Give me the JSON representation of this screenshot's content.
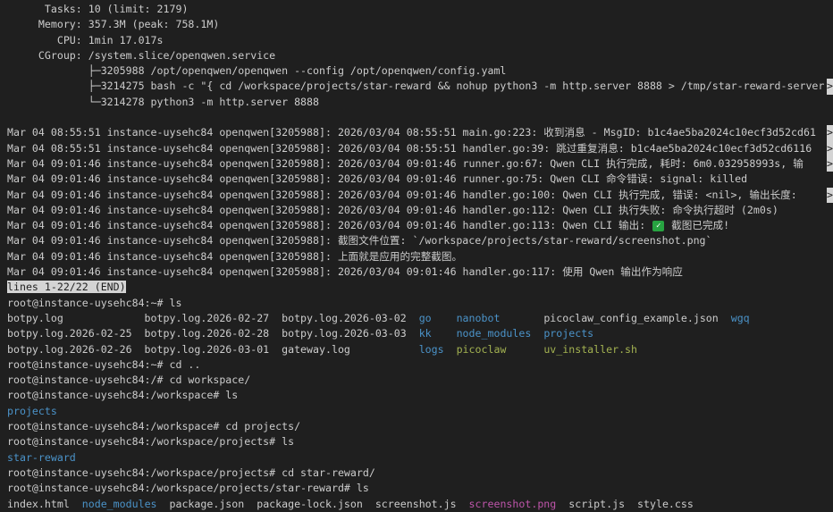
{
  "terminal": {
    "colors": {
      "background": "#1f1f1f",
      "foreground": "#cccccc",
      "directory_blue": "#4b93c9",
      "executable_green": "#a3b251",
      "image_magenta": "#be55aa",
      "inverse_bg": "#d4d4d4",
      "inverse_fg": "#1f1f1f",
      "check_green": "#27a341"
    },
    "service_status": {
      "tasks": "10 (limit: 2179)",
      "memory": "357.3M (peak: 758.1M)",
      "cpu": "1min 17.017s",
      "cgroup": "/system.slice/openqwen.service"
    },
    "pager_status": "lines 1-22/22 (END)",
    "lines": [
      {
        "segs": [
          "      Tasks: 10 (limit: 2179)"
        ]
      },
      {
        "segs": [
          "     Memory: 357.3M (peak: 758.1M)"
        ]
      },
      {
        "segs": [
          "        CPU: 1min 17.017s"
        ]
      },
      {
        "segs": [
          "     CGroup: /system.slice/openqwen.service"
        ]
      },
      {
        "segs": [
          "             ├─3205988 /opt/openqwen/openqwen --config /opt/openqwen/config.yaml"
        ]
      },
      {
        "segs": [
          "             ├─3214275 bash -c \"{ cd /workspace/projects/star-reward && nohup python3 -m http.server 8888 > /tmp/star-reward-server"
        ],
        "trunc": true
      },
      {
        "segs": [
          "             └─3214278 python3 -m http.server 8888"
        ]
      },
      {
        "segs": [
          ""
        ]
      },
      {
        "segs": [
          "Mar 04 08:55:51 instance-uysehc84 openqwen[3205988]: 2026/03/04 08:55:51 main.go:223: 收到消息 - MsgID: b1c4ae5ba2024c10ecf3d52cd61"
        ],
        "trunc": true
      },
      {
        "segs": [
          "Mar 04 08:55:51 instance-uysehc84 openqwen[3205988]: 2026/03/04 08:55:51 handler.go:39: 跳过重复消息: b1c4ae5ba2024c10ecf3d52cd6116"
        ],
        "trunc": true
      },
      {
        "segs": [
          "Mar 04 09:01:46 instance-uysehc84 openqwen[3205988]: 2026/03/04 09:01:46 runner.go:67: Qwen CLI 执行完成, 耗时: 6m0.032958993s, 输"
        ],
        "trunc": true
      },
      {
        "segs": [
          "Mar 04 09:01:46 instance-uysehc84 openqwen[3205988]: 2026/03/04 09:01:46 runner.go:75: Qwen CLI 命令错误: signal: killed"
        ]
      },
      {
        "segs": [
          "Mar 04 09:01:46 instance-uysehc84 openqwen[3205988]: 2026/03/04 09:01:46 handler.go:100: Qwen CLI 执行完成, 错误: <nil>, 输出长度: "
        ],
        "trunc": true
      },
      {
        "segs": [
          "Mar 04 09:01:46 instance-uysehc84 openqwen[3205988]: 2026/03/04 09:01:46 handler.go:112: Qwen CLI 执行失败: 命令执行超时 (2m0s)"
        ]
      },
      {
        "segs": [
          "Mar 04 09:01:46 instance-uysehc84 openqwen[3205988]: 2026/03/04 09:01:46 handler.go:113: Qwen CLI 输出: ",
          {
            "t": "✓",
            "c": "check"
          },
          " 截图已完成!"
        ]
      },
      {
        "segs": [
          "Mar 04 09:01:46 instance-uysehc84 openqwen[3205988]: 截图文件位置: `/workspace/projects/star-reward/screenshot.png`"
        ]
      },
      {
        "segs": [
          "Mar 04 09:01:46 instance-uysehc84 openqwen[3205988]: 上面就是应用的完整截图。"
        ]
      },
      {
        "segs": [
          "Mar 04 09:01:46 instance-uysehc84 openqwen[3205988]: 2026/03/04 09:01:46 handler.go:117: 使用 Qwen 输出作为响应"
        ]
      },
      {
        "segs": [
          {
            "t": "lines 1-22/22 (END)",
            "c": "inv"
          }
        ]
      },
      {
        "segs": [
          "root@instance-uysehc84:~# ls"
        ]
      },
      {
        "segs": [
          "botpy.log             botpy.log.2026-02-27  botpy.log.2026-03-02  ",
          {
            "t": "go",
            "c": "b"
          },
          "    ",
          {
            "t": "nanobot",
            "c": "b"
          },
          "       picoclaw_config_example.json  ",
          {
            "t": "wgq",
            "c": "b"
          }
        ]
      },
      {
        "segs": [
          "botpy.log.2026-02-25  botpy.log.2026-02-28  botpy.log.2026-03-03  ",
          {
            "t": "kk",
            "c": "b"
          },
          "    ",
          {
            "t": "node_modules",
            "c": "b"
          },
          "  ",
          {
            "t": "projects",
            "c": "b"
          }
        ]
      },
      {
        "segs": [
          "botpy.log.2026-02-26  botpy.log.2026-03-01  gateway.log           ",
          {
            "t": "logs",
            "c": "b"
          },
          "  ",
          {
            "t": "picoclaw",
            "c": "x"
          },
          "      ",
          {
            "t": "uv_installer.sh",
            "c": "x"
          }
        ]
      },
      {
        "segs": [
          "root@instance-uysehc84:~# cd .."
        ]
      },
      {
        "segs": [
          "root@instance-uysehc84:/# cd workspace/"
        ]
      },
      {
        "segs": [
          "root@instance-uysehc84:/workspace# ls"
        ]
      },
      {
        "segs": [
          {
            "t": "projects",
            "c": "b"
          }
        ]
      },
      {
        "segs": [
          "root@instance-uysehc84:/workspace# cd projects/"
        ]
      },
      {
        "segs": [
          "root@instance-uysehc84:/workspace/projects# ls"
        ]
      },
      {
        "segs": [
          {
            "t": "star-reward",
            "c": "b"
          }
        ]
      },
      {
        "segs": [
          "root@instance-uysehc84:/workspace/projects# cd star-reward/"
        ]
      },
      {
        "segs": [
          "root@instance-uysehc84:/workspace/projects/star-reward# ls"
        ]
      },
      {
        "segs": [
          "index.html  ",
          {
            "t": "node_modules",
            "c": "b"
          },
          "  package.json  package-lock.json  screenshot.js  ",
          {
            "t": "screenshot.png",
            "c": "m"
          },
          "  script.js  style.css"
        ]
      }
    ]
  }
}
